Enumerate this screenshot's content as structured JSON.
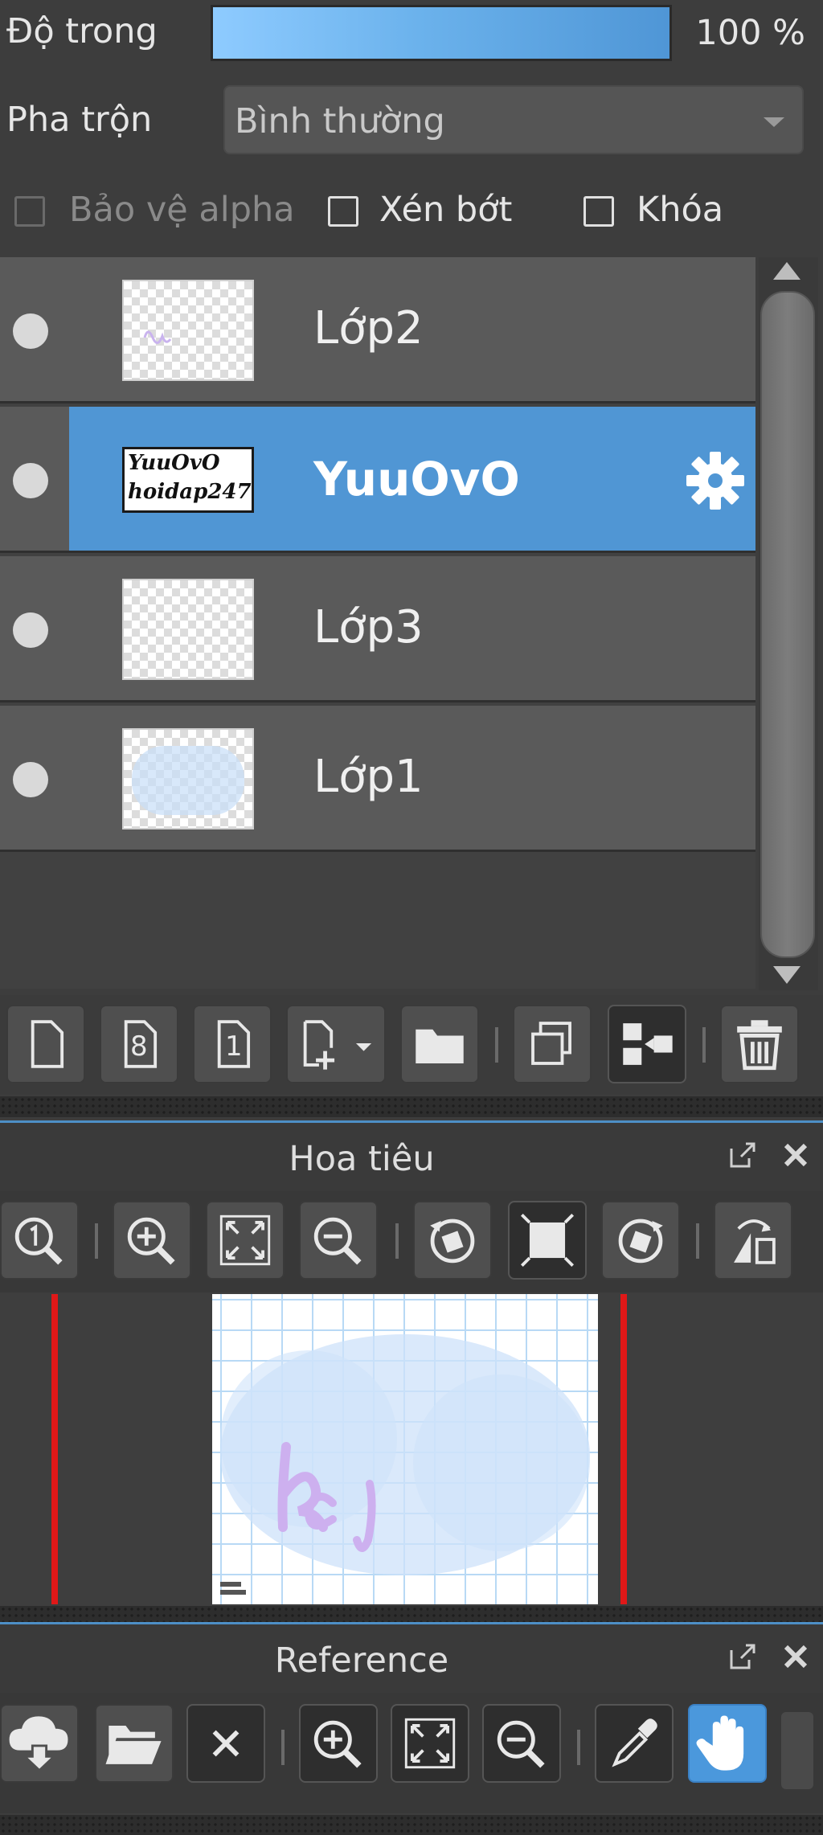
{
  "properties": {
    "opacity_label": "Độ trong",
    "opacity_value": "100 %",
    "opacity_fraction": 1.0,
    "blend_label": "Pha trộn",
    "blend_value": "Bình thường",
    "checkboxes": [
      {
        "label": "Bảo vệ alpha",
        "checked": false,
        "enabled": false
      },
      {
        "label": "Xén bớt",
        "checked": false,
        "enabled": true
      },
      {
        "label": "Khóa",
        "checked": false,
        "enabled": true
      }
    ]
  },
  "layers": [
    {
      "name": "Lớp2",
      "visible": true,
      "selected": false
    },
    {
      "name": "YuuOvO",
      "visible": true,
      "selected": true,
      "thumb_text": [
        "YuuOvO",
        "hoidap247"
      ]
    },
    {
      "name": "Lớp3",
      "visible": true,
      "selected": false
    },
    {
      "name": "Lớp1",
      "visible": true,
      "selected": false
    }
  ],
  "layer_toolbar": {
    "buttons": [
      "new-layer-icon",
      "new-8bit-layer-icon",
      "new-1bit-layer-icon",
      "add-layer-dropdown-icon",
      "folder-icon",
      "duplicate-icon",
      "merge-down-icon",
      "trash-icon"
    ],
    "badge_8": "8",
    "badge_1": "1"
  },
  "navigator": {
    "title": "Hoa tiêu",
    "tools": [
      "zoom-actual-icon",
      "zoom-in-icon",
      "fit-screen-icon",
      "zoom-out-icon",
      "rotate-left-icon",
      "reset-view-icon",
      "rotate-right-icon",
      "flip-horizontal-icon"
    ]
  },
  "reference": {
    "title": "Reference",
    "tools": [
      "cloud-download-icon",
      "open-folder-icon",
      "close-icon",
      "zoom-in-icon",
      "fit-screen-icon",
      "zoom-out-icon",
      "eyedropper-icon",
      "hand-icon"
    ]
  },
  "colors": {
    "accent": "#5096d4",
    "panel": "#3d3d3d",
    "row": "#5a5a5a",
    "red_line": "#e01818"
  }
}
